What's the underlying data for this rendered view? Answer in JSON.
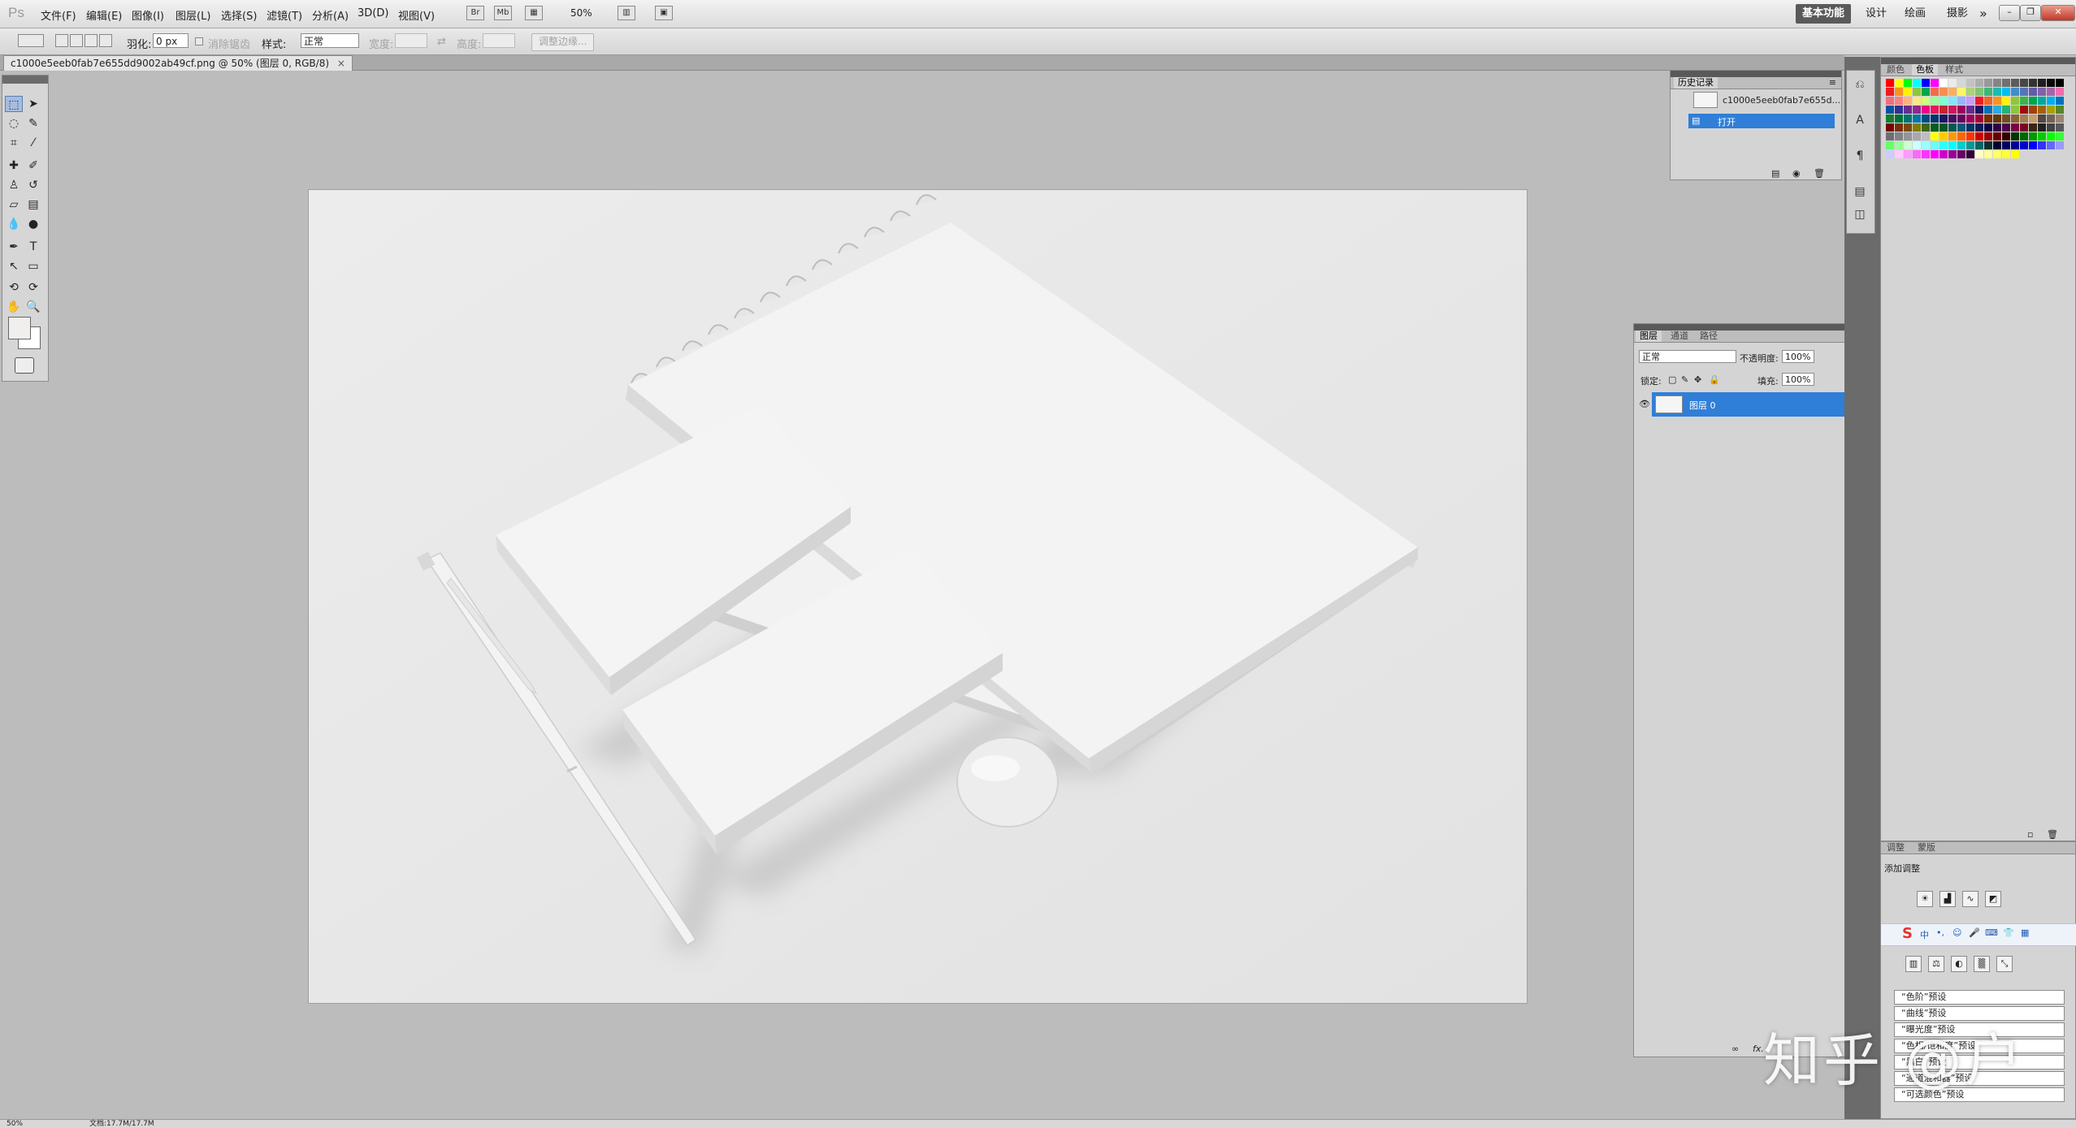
{
  "app": {
    "logo": "Ps"
  },
  "menu": [
    "文件(F)",
    "编辑(E)",
    "图像(I)",
    "图层(L)",
    "选择(S)",
    "滤镜(T)",
    "分析(A)",
    "3D(D)",
    "视图(V)"
  ],
  "menubar": {
    "zoom": "50%",
    "workspaces": [
      "基本功能",
      "设计",
      "绘画",
      "摄影"
    ],
    "more": "»"
  },
  "options": {
    "feather_label": "羽化:",
    "feather_value": "0 px",
    "antialias_label": "消除锯齿",
    "style_label": "样式:",
    "style_value": "正常",
    "width_label": "宽度:",
    "height_label": "高度:",
    "refine_edge": "调整边缘..."
  },
  "document": {
    "tab_title": "c1000e5eeb0fab7e655dd9002ab49cf.png @ 50% (图层 0, RGB/8)",
    "close": "×"
  },
  "status": {
    "zoom": "50%",
    "doc_size": "文档:17.7M/17.7M"
  },
  "history_panel": {
    "tab": "历史记录",
    "snapshot_name": "c1000e5eeb0fab7e655d...",
    "steps": [
      "打开"
    ]
  },
  "layers_panel": {
    "tabs": [
      "图层",
      "通道",
      "路径"
    ],
    "blend_mode": "正常",
    "opacity_label": "不透明度:",
    "opacity_value": "100%",
    "lock_label": "锁定:",
    "fill_label": "填充:",
    "fill_value": "100%",
    "layers": [
      {
        "name": "图层 0",
        "visible": true,
        "selected": true
      }
    ],
    "footer": "fx."
  },
  "swatches_panel": {
    "tabs": [
      "颜色",
      "色板",
      "样式"
    ],
    "colors": [
      "#ff0000",
      "#ffff00",
      "#00ff00",
      "#00ffff",
      "#0000ff",
      "#ff00ff",
      "#ffffff",
      "#ebebeb",
      "#d6d6d6",
      "#c2c2c2",
      "#adadad",
      "#999999",
      "#858585",
      "#707070",
      "#5c5c5c",
      "#474747",
      "#333333",
      "#1f1f1f",
      "#0a0a0a",
      "#000000",
      "#ed1c24",
      "#f7941d",
      "#fff200",
      "#8dc63f",
      "#00a651",
      "#f26c4f",
      "#f68e56",
      "#fbaf5d",
      "#fff568",
      "#acd373",
      "#7cc576",
      "#3bb878",
      "#1abbb4",
      "#00bff3",
      "#438ccb",
      "#5574b9",
      "#605ca8",
      "#855fa8",
      "#a763a9",
      "#f06eaa",
      "#f26d7d",
      "#ff8080",
      "#ffb380",
      "#ffe680",
      "#ccff80",
      "#99ff99",
      "#80ffcc",
      "#80e6ff",
      "#99b3ff",
      "#cc99ff",
      "#ed1c24",
      "#f26522",
      "#f7941d",
      "#fff200",
      "#8dc63f",
      "#39b54a",
      "#00a651",
      "#00a99d",
      "#00aeef",
      "#0072bc",
      "#0054a6",
      "#2e3192",
      "#662d91",
      "#92278f",
      "#ec008c",
      "#ed145b",
      "#c1272d",
      "#d4145a",
      "#9e005d",
      "#662d91",
      "#1b1464",
      "#0071bc",
      "#29abe2",
      "#22b573",
      "#8cc63f",
      "#9e0b0f",
      "#a0410d",
      "#a36209",
      "#aba000",
      "#598527",
      "#1a7b30",
      "#007236",
      "#00746b",
      "#0076a3",
      "#004b80",
      "#003471",
      "#1b1464",
      "#440e62",
      "#630460",
      "#9e005d",
      "#9e0039",
      "#7b2e00",
      "#603913",
      "#754c24",
      "#8c6239",
      "#a67c52",
      "#c69c6d",
      "#534741",
      "#736357",
      "#998675",
      "#790000",
      "#7b2e00",
      "#7d4900",
      "#827b00",
      "#406618",
      "#005e20",
      "#005826",
      "#005952",
      "#005b7f",
      "#003663",
      "#002157",
      "#0d004c",
      "#32004b",
      "#4b0049",
      "#7b0046",
      "#7a0026",
      "#3c2415",
      "#231f20",
      "#414042",
      "#58595b",
      "#6d6e71",
      "#808285",
      "#939598",
      "#a7a9ac",
      "#bcbec0",
      "#ffff00",
      "#ffcc00",
      "#ff9900",
      "#ff6600",
      "#ff3300",
      "#cc0000",
      "#990000",
      "#660000",
      "#330000",
      "#003300",
      "#006600",
      "#009900",
      "#00cc00",
      "#00ff00",
      "#33ff33",
      "#66ff66",
      "#99ff99",
      "#ccffcc",
      "#ccffff",
      "#99ffff",
      "#66ffff",
      "#33ffff",
      "#00ffff",
      "#00cccc",
      "#009999",
      "#006666",
      "#003333",
      "#000033",
      "#000066",
      "#000099",
      "#0000cc",
      "#0000ff",
      "#3333ff",
      "#6666ff",
      "#9999ff",
      "#ccccff",
      "#ffccff",
      "#ff99ff",
      "#ff66ff",
      "#ff33ff",
      "#ff00ff",
      "#cc00cc",
      "#990099",
      "#660066",
      "#330033",
      "#ffffcc",
      "#ffff99",
      "#ffff66",
      "#ffff33",
      "#ffff00"
    ]
  },
  "adjustments_panel": {
    "tabs": [
      "调整",
      "蒙版"
    ],
    "title": "添加调整",
    "presets": [
      "“色阶”预设",
      "“曲线”预设",
      "“曝光度”预设",
      "“色相/饱和度”预设",
      "“黑白”预设",
      "“通道混和器”预设",
      "“可选颜色”预设"
    ]
  },
  "ime_toolbar": {
    "logo": "S",
    "lang": "中"
  },
  "watermark": "知乎 @户"
}
